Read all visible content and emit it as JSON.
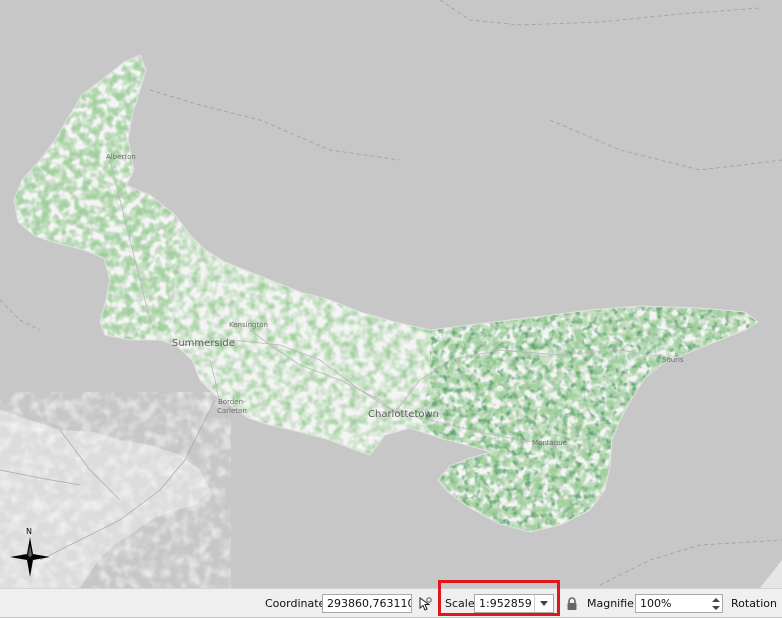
{
  "map": {
    "place_labels": {
      "alberton": "Alberton",
      "kensington": "Kensington",
      "summerside": "Summerside",
      "borden_carleton_1": "Borden-",
      "borden_carleton_2": "Carleton",
      "charlottetown": "Charlottetown",
      "montague": "Montague",
      "souris": "Souris"
    },
    "north_arrow_label": "N",
    "colors": {
      "background": "#c7c7c7",
      "land": "#f4f4f4",
      "forest_light": "#9fd08f",
      "forest_mid": "#5fa85a",
      "forest_dark": "#1f5b2a"
    }
  },
  "statusbar": {
    "coordinate_label": "Coordinate",
    "coordinate_value": "293860,763110",
    "toggle_extents_icon": "mouse-pointer-toggle-icon",
    "scale_label": "Scale",
    "scale_value": "1:952859",
    "lock_icon": "lock-icon",
    "magnifier_label": "Magnifier",
    "magnifier_value": "100%",
    "rotation_label": "Rotation",
    "highlight_color": "#e0161e"
  }
}
